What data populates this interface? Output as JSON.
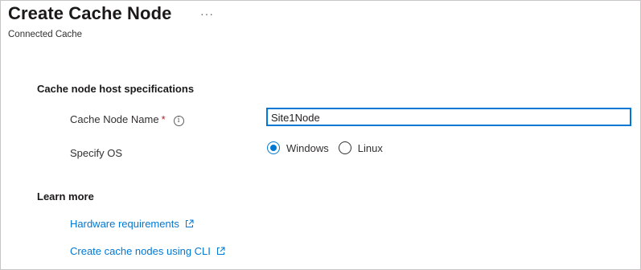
{
  "header": {
    "title": "Create Cache Node",
    "more_label": "···",
    "subtitle": "Connected Cache"
  },
  "host_specs": {
    "heading": "Cache node host specifications",
    "name_label": "Cache Node Name",
    "required_mark": "*",
    "info_icon": "i",
    "name_value": "Site1Node",
    "os_label": "Specify OS",
    "os_options": [
      "Windows",
      "Linux"
    ],
    "os_selected": "Windows"
  },
  "learn_more": {
    "heading": "Learn more",
    "links": [
      "Hardware requirements",
      "Create cache nodes using CLI"
    ]
  },
  "colors": {
    "accent": "#0078d4",
    "required": "#a4262c"
  },
  "icons": {
    "info": "info-icon",
    "external_link": "external-link-icon",
    "radio_selected": "radio-selected",
    "radio_unselected": "radio-unselected"
  }
}
